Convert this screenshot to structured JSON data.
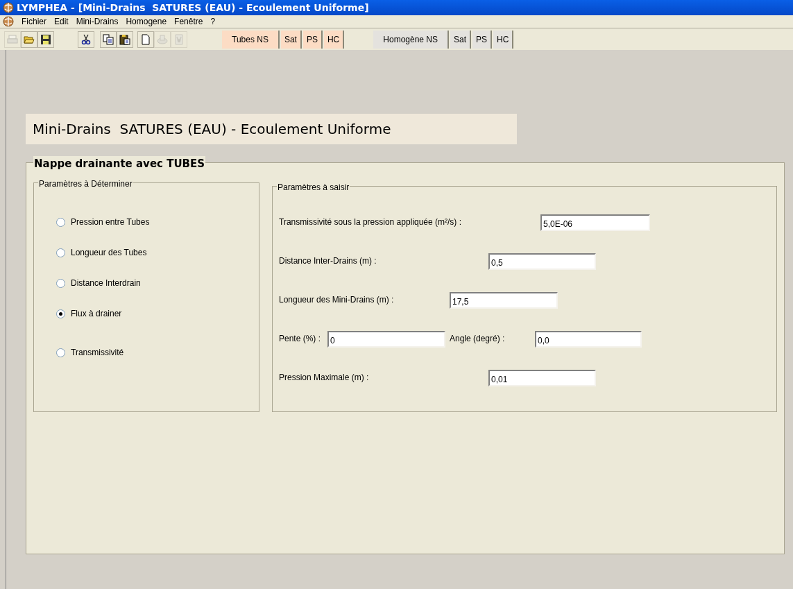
{
  "window": {
    "title": "LYMPHEA - [Mini-Drains  SATURES (EAU) - Ecoulement Uniforme]"
  },
  "menu": [
    "Fichier",
    "Edit",
    "Mini-Drains",
    "Homogene",
    "Fenêtre",
    "?"
  ],
  "toolbar": {
    "tools": [
      {
        "kind": "print",
        "disabled": true
      },
      {
        "kind": "open",
        "disabled": false
      },
      {
        "kind": "save",
        "disabled": false
      },
      {
        "kind": "cut",
        "disabled": false
      },
      {
        "kind": "copy",
        "disabled": false
      },
      {
        "kind": "paste",
        "disabled": false
      },
      {
        "kind": "new",
        "disabled": false
      },
      {
        "kind": "disk",
        "disabled": true
      },
      {
        "kind": "word",
        "disabled": true
      }
    ],
    "mode_groups": [
      {
        "selected": true,
        "buttons": [
          "Tubes NS",
          "Sat",
          "PS",
          "HC"
        ]
      },
      {
        "selected": false,
        "buttons": [
          "Homogène NS",
          "Sat",
          "PS",
          "HC"
        ]
      }
    ]
  },
  "banner": "Mini-Drains  SATURES (EAU) - Ecoulement Uniforme",
  "panel": {
    "title": "Nappe drainante avec TUBES",
    "determine": {
      "title": "Paramètres à Déterminer",
      "options": [
        {
          "label": "Pression entre Tubes",
          "selected": false
        },
        {
          "label": "Longueur des Tubes",
          "selected": false
        },
        {
          "label": "Distance Interdrain",
          "selected": false
        },
        {
          "label": "Flux à drainer",
          "selected": true
        },
        {
          "label": "Transmissivité",
          "selected": false
        }
      ]
    },
    "inputs": {
      "title": "Paramètres à saisir",
      "rows": [
        [
          {
            "label": "Transmissivité sous la pression appliquée (m²/s) :",
            "value": "5,0E-06"
          }
        ],
        [
          {
            "label": "Distance Inter-Drains (m) :",
            "value": "0,5"
          }
        ],
        [
          {
            "label": "Longueur des Mini-Drains (m) :",
            "value": "17,5"
          }
        ],
        [
          {
            "label": "Pente (%) :",
            "value": "0"
          },
          {
            "label": "Angle (degré) :",
            "value": "0,0"
          }
        ],
        [
          {
            "label": "Pression Maximale (m) :",
            "value": "0,01"
          }
        ]
      ]
    }
  }
}
